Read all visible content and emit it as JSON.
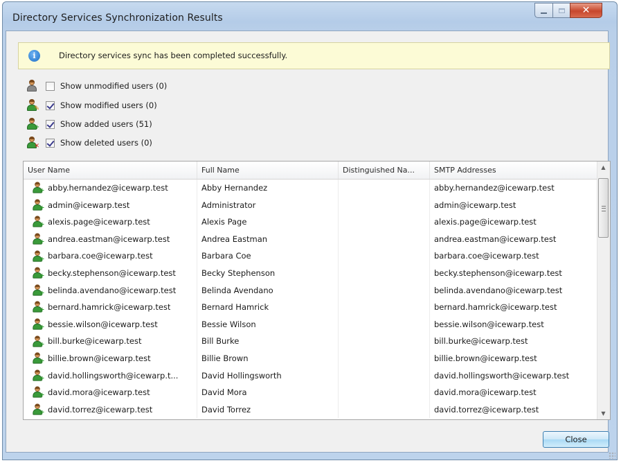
{
  "window": {
    "title": "Directory Services Synchronization Results",
    "close_glyph": "✕"
  },
  "banner": {
    "icon": "info-icon",
    "text": "Directory services sync has been completed successfully."
  },
  "filters": [
    {
      "label": "Show unmodified users (0)",
      "checked": false,
      "icon": "user-gray-icon"
    },
    {
      "label": "Show modified users (0)",
      "checked": true,
      "icon": "user-modified-icon"
    },
    {
      "label": "Show added users (51)",
      "checked": true,
      "icon": "user-added-icon"
    },
    {
      "label": "Show deleted users (0)",
      "checked": true,
      "icon": "user-deleted-icon"
    }
  ],
  "table": {
    "columns": [
      "User Name",
      "Full Name",
      "Distinguished Na...",
      "SMTP Addresses"
    ],
    "rows": [
      {
        "user": "abby.hernandez@icewarp.test",
        "full": "Abby Hernandez",
        "dn": "",
        "smtp": "abby.hernandez@icewarp.test"
      },
      {
        "user": "admin@icewarp.test",
        "full": "Administrator",
        "dn": "",
        "smtp": "admin@icewarp.test"
      },
      {
        "user": "alexis.page@icewarp.test",
        "full": "Alexis Page",
        "dn": "",
        "smtp": "alexis.page@icewarp.test"
      },
      {
        "user": "andrea.eastman@icewarp.test",
        "full": "Andrea Eastman",
        "dn": "",
        "smtp": "andrea.eastman@icewarp.test"
      },
      {
        "user": "barbara.coe@icewarp.test",
        "full": "Barbara Coe",
        "dn": "",
        "smtp": "barbara.coe@icewarp.test"
      },
      {
        "user": "becky.stephenson@icewarp.test",
        "full": "Becky Stephenson",
        "dn": "",
        "smtp": "becky.stephenson@icewarp.test"
      },
      {
        "user": "belinda.avendano@icewarp.test",
        "full": "Belinda Avendano",
        "dn": "",
        "smtp": "belinda.avendano@icewarp.test"
      },
      {
        "user": "bernard.hamrick@icewarp.test",
        "full": "Bernard Hamrick",
        "dn": "",
        "smtp": "bernard.hamrick@icewarp.test"
      },
      {
        "user": "bessie.wilson@icewarp.test",
        "full": "Bessie Wilson",
        "dn": "",
        "smtp": "bessie.wilson@icewarp.test"
      },
      {
        "user": "bill.burke@icewarp.test",
        "full": "Bill Burke",
        "dn": "",
        "smtp": "bill.burke@icewarp.test"
      },
      {
        "user": "billie.brown@icewarp.test",
        "full": "Billie Brown",
        "dn": "",
        "smtp": "billie.brown@icewarp.test"
      },
      {
        "user": "david.hollingsworth@icewarp.t...",
        "full": "David Hollingsworth",
        "dn": "",
        "smtp": "david.hollingsworth@icewarp.test"
      },
      {
        "user": "david.mora@icewarp.test",
        "full": "David Mora",
        "dn": "",
        "smtp": "david.mora@icewarp.test"
      },
      {
        "user": "david.torrez@icewarp.test",
        "full": "David Torrez",
        "dn": "",
        "smtp": "david.torrez@icewarp.test"
      }
    ]
  },
  "buttons": {
    "close_label": "Close"
  }
}
